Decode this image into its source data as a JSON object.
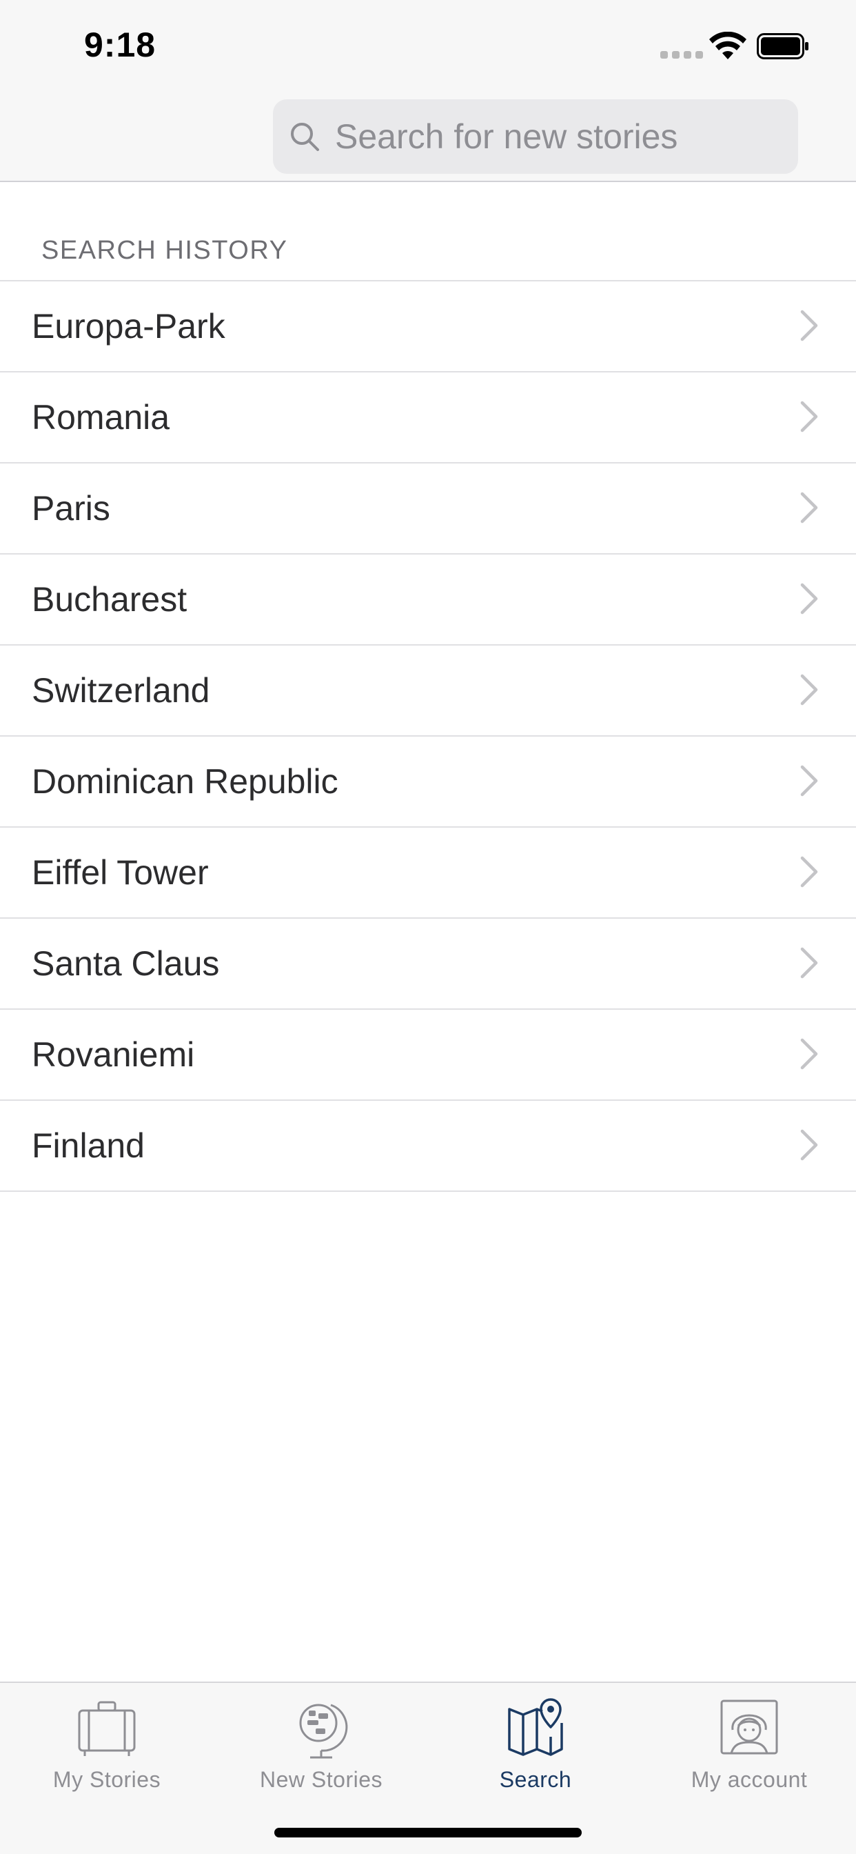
{
  "status_bar": {
    "time": "9:18",
    "icons": [
      "cellular-signal-icon",
      "wifi-icon",
      "battery-icon"
    ]
  },
  "search": {
    "placeholder": "Search for new stories",
    "value": ""
  },
  "history": {
    "header": "SEARCH HISTORY",
    "items": [
      {
        "label": "Europa-Park"
      },
      {
        "label": "Romania"
      },
      {
        "label": "Paris"
      },
      {
        "label": "Bucharest"
      },
      {
        "label": "Switzerland"
      },
      {
        "label": "Dominican Republic"
      },
      {
        "label": "Eiffel Tower"
      },
      {
        "label": "Santa Claus"
      },
      {
        "label": "Rovaniemi"
      },
      {
        "label": "Finland"
      }
    ]
  },
  "tab_bar": {
    "tabs": [
      {
        "label": "My Stories",
        "icon": "suitcase-icon",
        "active": false
      },
      {
        "label": "New Stories",
        "icon": "globe-icon",
        "active": false
      },
      {
        "label": "Search",
        "icon": "map-pin-icon",
        "active": true
      },
      {
        "label": "My account",
        "icon": "user-avatar-icon",
        "active": false
      }
    ]
  },
  "colors": {
    "active_tab": "#1b3a63",
    "inactive_tab": "#8e8e93",
    "bar_background": "#f7f7f7",
    "search_field": "#e9e9eb"
  }
}
